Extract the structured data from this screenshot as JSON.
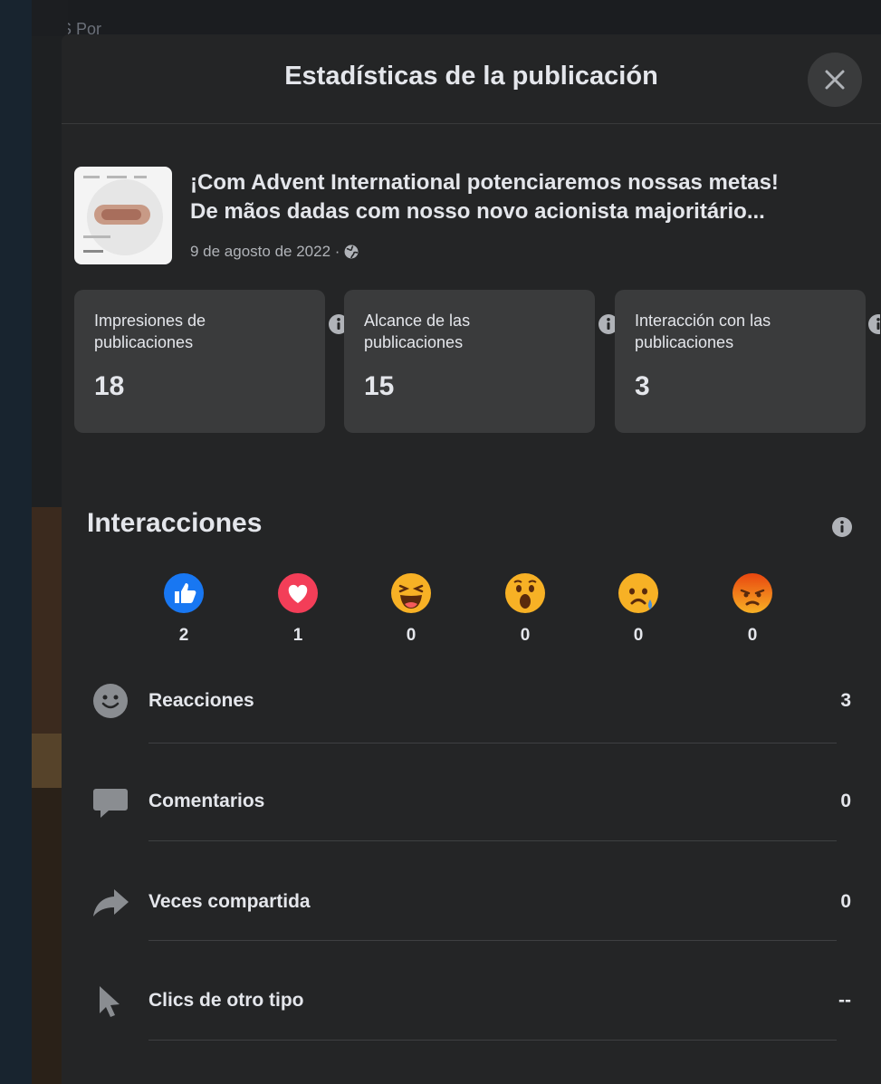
{
  "background": {
    "top_text": "ORIS Por"
  },
  "modal": {
    "title": "Estadísticas de la publicación",
    "close_icon": "close-icon"
  },
  "post": {
    "text_line1": "¡Com Advent International potenciaremos nossas metas!",
    "text_line2": "De mãos dadas com nosso novo acionista majoritário...",
    "date": "9 de agosto de 2022 ·",
    "audience_icon": "globe-icon"
  },
  "stats": [
    {
      "label": "Impresiones de publicaciones",
      "value": "18"
    },
    {
      "label": "Alcance de las publicaciones",
      "value": "15"
    },
    {
      "label": "Interacción con las publicaciones",
      "value": "3"
    }
  ],
  "interactions": {
    "title": "Interacciones",
    "reactions": [
      {
        "icon": "like-icon",
        "count": "2",
        "color": "#1877f2"
      },
      {
        "icon": "love-icon",
        "count": "1",
        "color": "#f33e58"
      },
      {
        "icon": "haha-icon",
        "count": "0",
        "color": "#f7b125"
      },
      {
        "icon": "wow-icon",
        "count": "0",
        "color": "#f7b125"
      },
      {
        "icon": "sad-icon",
        "count": "0",
        "color": "#f7b125"
      },
      {
        "icon": "angry-icon",
        "count": "0",
        "color": "#e9710f"
      }
    ],
    "metrics": [
      {
        "icon": "smiley-icon",
        "label": "Reacciones",
        "value": "3"
      },
      {
        "icon": "comment-icon",
        "label": "Comentarios",
        "value": "0"
      },
      {
        "icon": "share-icon",
        "label": "Veces compartida",
        "value": "0"
      },
      {
        "icon": "cursor-icon",
        "label": "Clics de otro tipo",
        "value": "--"
      }
    ]
  },
  "colors": {
    "modal_bg": "#242526",
    "card_bg": "#3a3b3c",
    "text": "#e4e6eb",
    "secondary_text": "#b0b3b8"
  }
}
